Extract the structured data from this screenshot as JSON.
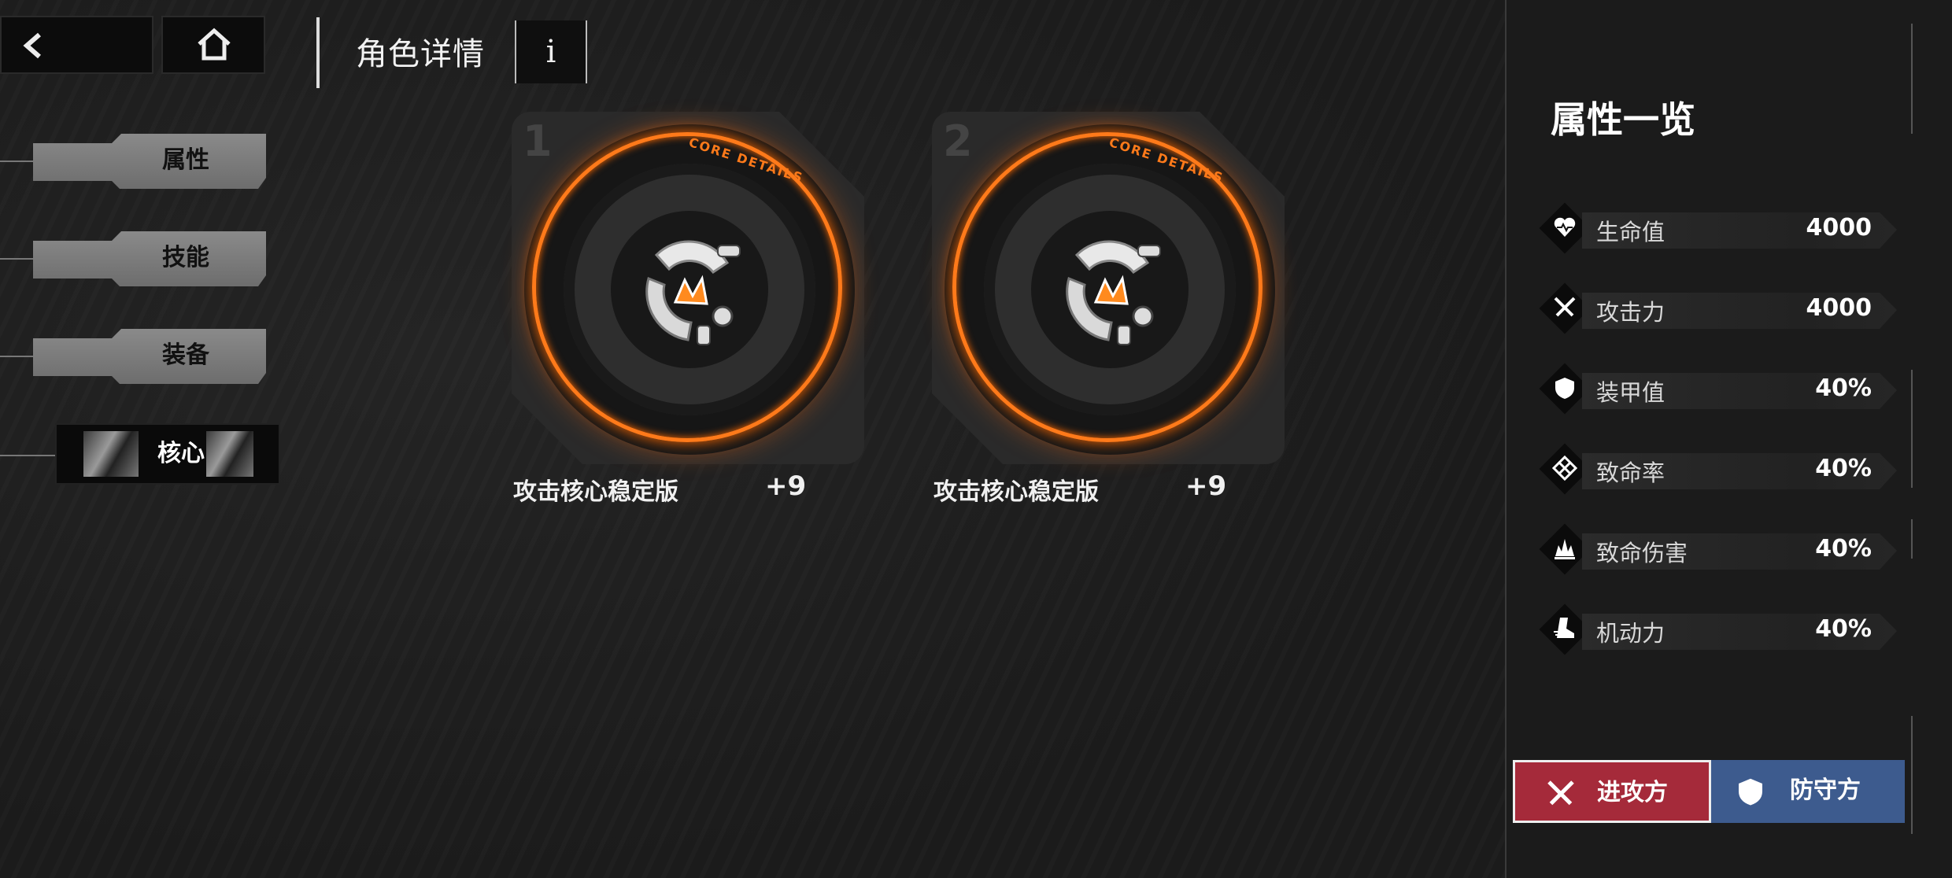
{
  "header": {
    "title": "角色详情",
    "info_label": "i"
  },
  "tabs": [
    {
      "label": "属性"
    },
    {
      "label": "技能"
    },
    {
      "label": "装备"
    },
    {
      "label": "核心"
    }
  ],
  "cores": [
    {
      "slot": "1",
      "badge": "CORE DETAILS",
      "name": "攻击核心稳定版",
      "level": "+9"
    },
    {
      "slot": "2",
      "badge": "CORE DETAILS",
      "name": "攻击核心稳定版",
      "level": "+9"
    }
  ],
  "panel": {
    "title": "属性一览",
    "stats": [
      {
        "icon": "heart-icon",
        "label": "生命值",
        "value": "4000"
      },
      {
        "icon": "crossed-swords-icon",
        "label": "攻击力",
        "value": "4000"
      },
      {
        "icon": "shield-icon",
        "label": "装甲值",
        "value": "40%"
      },
      {
        "icon": "crit-diamond-icon",
        "label": "致命率",
        "value": "40%"
      },
      {
        "icon": "explosion-icon",
        "label": "致命伤害",
        "value": "40%"
      },
      {
        "icon": "boot-icon",
        "label": "机动力",
        "value": "40%"
      }
    ],
    "attacker_label": "进攻方",
    "defender_label": "防守方"
  },
  "colors": {
    "accent_orange": "#ff7a1a",
    "attacker_red": "#a52a3a",
    "defender_blue": "#3d5b8e"
  }
}
